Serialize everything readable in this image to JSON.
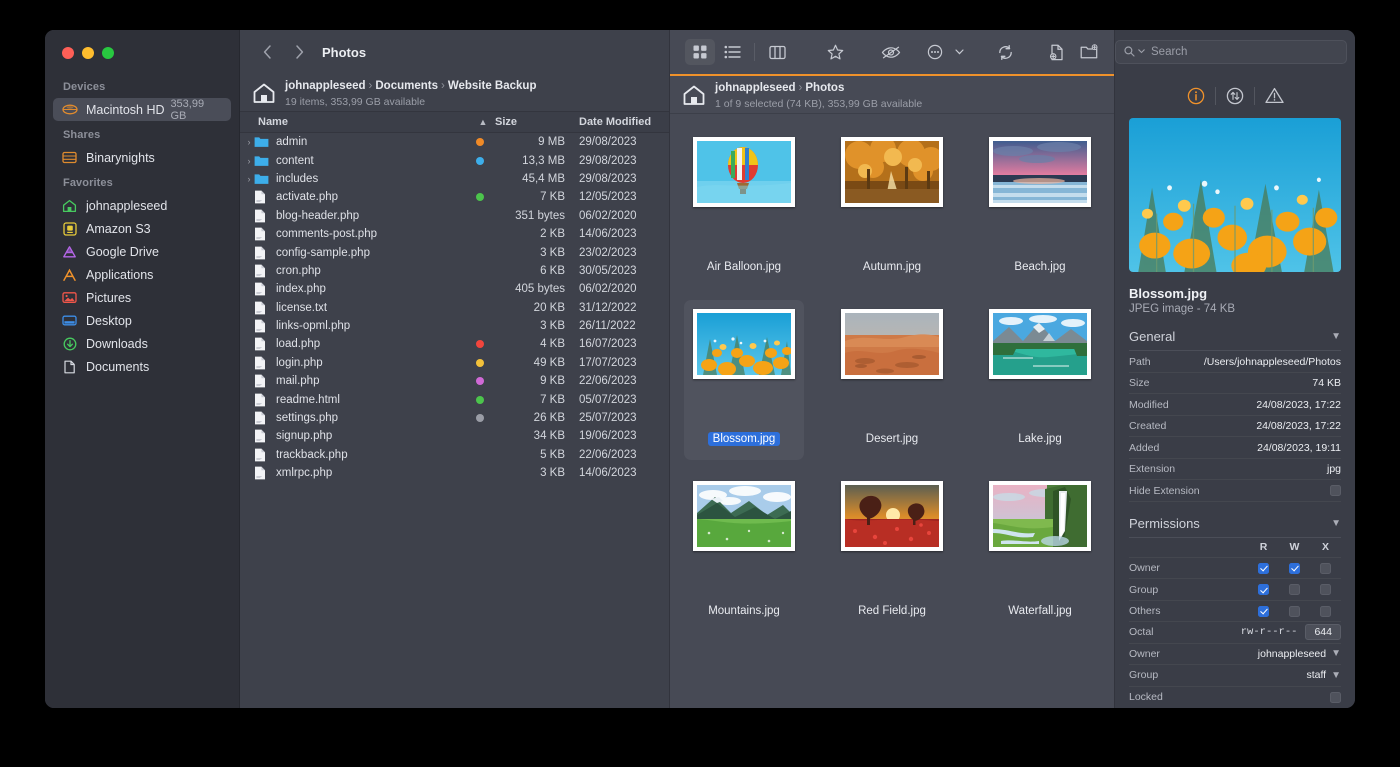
{
  "window": {
    "title": "Photos",
    "traffic_lights": [
      "close-red",
      "minimize-yellow",
      "zoom-green"
    ]
  },
  "sidebar": {
    "groups": [
      {
        "title": "Devices",
        "items": [
          {
            "label": "Macintosh HD",
            "meta": "353,99 GB",
            "icon": "harddisk-icon",
            "selected": true
          }
        ]
      },
      {
        "title": "Shares",
        "items": [
          {
            "label": "Binarynights",
            "meta": "",
            "icon": "server-icon",
            "selected": false
          }
        ]
      },
      {
        "title": "Favorites",
        "items": [
          {
            "label": "johnappleseed",
            "meta": "",
            "icon": "home-icon",
            "selected": false
          },
          {
            "label": "Amazon S3",
            "meta": "",
            "icon": "amazon-s3-icon",
            "selected": false
          },
          {
            "label": "Google Drive",
            "meta": "",
            "icon": "google-drive-icon",
            "selected": false
          },
          {
            "label": "Applications",
            "meta": "",
            "icon": "applications-icon",
            "selected": false
          },
          {
            "label": "Pictures",
            "meta": "",
            "icon": "pictures-icon",
            "selected": false
          },
          {
            "label": "Desktop",
            "meta": "",
            "icon": "desktop-icon",
            "selected": false
          },
          {
            "label": "Downloads",
            "meta": "",
            "icon": "downloads-icon",
            "selected": false
          },
          {
            "label": "Documents",
            "meta": "",
            "icon": "document-icon",
            "selected": false
          }
        ]
      }
    ]
  },
  "toolbar": {
    "back_icon": "chevron-left-icon",
    "forward_icon": "chevron-right-icon",
    "title": "Photos",
    "view_icon_grid": "grid-view-icon",
    "view_list": "list-view-icon",
    "view_column": "column-view-icon",
    "favorite": "star-icon",
    "hidden_files": "eye-slash-icon",
    "more": "ellipsis-circle-icon",
    "more_chevron": "chevron-down-icon",
    "sync": "refresh-icon",
    "new_file": "new-file-icon",
    "new_folder": "new-folder-icon"
  },
  "search": {
    "placeholder": "Search",
    "icon": "search-icon",
    "chevron": "chevron-down-icon"
  },
  "list_pane": {
    "breadcrumb": [
      "johnappleseed",
      "Documents",
      "Website Backup"
    ],
    "status": "19 items, 353,99 GB available",
    "columns": {
      "name": "Name",
      "size": "Size",
      "date": "Date Modified",
      "sort_icon": "sort-ascending-icon"
    },
    "rows": [
      {
        "name": "admin",
        "type": "folder",
        "expandable": true,
        "tag": "#f08a27",
        "size": "9 MB",
        "date": "29/08/2023"
      },
      {
        "name": "content",
        "type": "folder",
        "expandable": true,
        "tag": "#3daeea",
        "size": "13,3 MB",
        "date": "29/08/2023"
      },
      {
        "name": "includes",
        "type": "folder",
        "expandable": true,
        "tag": "",
        "size": "45,4 MB",
        "date": "29/08/2023"
      },
      {
        "name": "activate.php",
        "type": "file",
        "expandable": false,
        "tag": "#4cc44c",
        "size": "7 KB",
        "date": "12/05/2023"
      },
      {
        "name": "blog-header.php",
        "type": "file",
        "expandable": false,
        "tag": "",
        "size": "351 bytes",
        "date": "06/02/2020"
      },
      {
        "name": "comments-post.php",
        "type": "file",
        "expandable": false,
        "tag": "",
        "size": "2 KB",
        "date": "14/06/2023"
      },
      {
        "name": "config-sample.php",
        "type": "file",
        "expandable": false,
        "tag": "",
        "size": "3 KB",
        "date": "23/02/2023"
      },
      {
        "name": "cron.php",
        "type": "file",
        "expandable": false,
        "tag": "",
        "size": "6 KB",
        "date": "30/05/2023"
      },
      {
        "name": "index.php",
        "type": "file",
        "expandable": false,
        "tag": "",
        "size": "405 bytes",
        "date": "06/02/2020"
      },
      {
        "name": "license.txt",
        "type": "file",
        "expandable": false,
        "tag": "",
        "size": "20 KB",
        "date": "31/12/2022"
      },
      {
        "name": "links-opml.php",
        "type": "file",
        "expandable": false,
        "tag": "",
        "size": "3 KB",
        "date": "26/11/2022"
      },
      {
        "name": "load.php",
        "type": "file",
        "expandable": false,
        "tag": "#f2453d",
        "size": "4 KB",
        "date": "16/07/2023"
      },
      {
        "name": "login.php",
        "type": "file",
        "expandable": false,
        "tag": "#f3c13a",
        "size": "49 KB",
        "date": "17/07/2023"
      },
      {
        "name": "mail.php",
        "type": "file",
        "expandable": false,
        "tag": "#d069d6",
        "size": "9 KB",
        "date": "22/06/2023"
      },
      {
        "name": "readme.html",
        "type": "file",
        "expandable": false,
        "tag": "#4cc44c",
        "size": "7 KB",
        "date": "05/07/2023"
      },
      {
        "name": "settings.php",
        "type": "file",
        "expandable": false,
        "tag": "#9a9da6",
        "size": "26 KB",
        "date": "25/07/2023"
      },
      {
        "name": "signup.php",
        "type": "file",
        "expandable": false,
        "tag": "",
        "size": "34 KB",
        "date": "19/06/2023"
      },
      {
        "name": "trackback.php",
        "type": "file",
        "expandable": false,
        "tag": "",
        "size": "5 KB",
        "date": "22/06/2023"
      },
      {
        "name": "xmlrpc.php",
        "type": "file",
        "expandable": false,
        "tag": "",
        "size": "3 KB",
        "date": "14/06/2023"
      }
    ]
  },
  "icon_pane": {
    "breadcrumb": [
      "johnappleseed",
      "Photos"
    ],
    "status": "1 of 9 selected (74 KB), 353,99 GB available",
    "accent_color": "#f0922b",
    "items": [
      {
        "label": "Air Balloon.jpg",
        "selected": false,
        "art": "balloon"
      },
      {
        "label": "Autumn.jpg",
        "selected": false,
        "art": "autumn"
      },
      {
        "label": "Beach.jpg",
        "selected": false,
        "art": "beach"
      },
      {
        "label": "Blossom.jpg",
        "selected": true,
        "art": "blossom"
      },
      {
        "label": "Desert.jpg",
        "selected": false,
        "art": "desert"
      },
      {
        "label": "Lake.jpg",
        "selected": false,
        "art": "lake"
      },
      {
        "label": "Mountains.jpg",
        "selected": false,
        "art": "mountains"
      },
      {
        "label": "Red Field.jpg",
        "selected": false,
        "art": "redfield"
      },
      {
        "label": "Waterfall.jpg",
        "selected": false,
        "art": "waterfall"
      }
    ]
  },
  "inspector": {
    "tabs": [
      {
        "icon": "info-icon",
        "active": true
      },
      {
        "icon": "transfer-icon",
        "active": false
      },
      {
        "icon": "warning-icon",
        "active": false
      }
    ],
    "preview_art": "blossom",
    "file_name": "Blossom.jpg",
    "file_sub": "JPEG image - 74 KB",
    "general": {
      "title": "General",
      "chevron": "chevron-down-icon",
      "rows": [
        {
          "label": "Path",
          "value": "/Users/johnappleseed/Photos"
        },
        {
          "label": "Size",
          "value": "74 KB"
        },
        {
          "label": "Modified",
          "value": "24/08/2023, 17:22"
        },
        {
          "label": "Created",
          "value": "24/08/2023, 17:22"
        },
        {
          "label": "Added",
          "value": "24/08/2023, 19:11"
        },
        {
          "label": "Extension",
          "value": "jpg"
        }
      ],
      "hide_extension": {
        "label": "Hide Extension",
        "checked": false
      }
    },
    "permissions": {
      "title": "Permissions",
      "chevron": "chevron-down-icon",
      "columns": [
        "R",
        "W",
        "X"
      ],
      "rows": [
        {
          "label": "Owner",
          "r": true,
          "w": true,
          "x": false
        },
        {
          "label": "Group",
          "r": true,
          "w": false,
          "x": false
        },
        {
          "label": "Others",
          "r": true,
          "w": false,
          "x": false
        }
      ],
      "octal": {
        "label": "Octal",
        "symbolic": "rw-r--r--",
        "value": "644"
      },
      "owner": {
        "label": "Owner",
        "value": "johnappleseed",
        "chevron": "chevron-down-icon"
      },
      "group": {
        "label": "Group",
        "value": "staff",
        "chevron": "chevron-down-icon"
      },
      "locked": {
        "label": "Locked",
        "checked": false
      }
    }
  }
}
